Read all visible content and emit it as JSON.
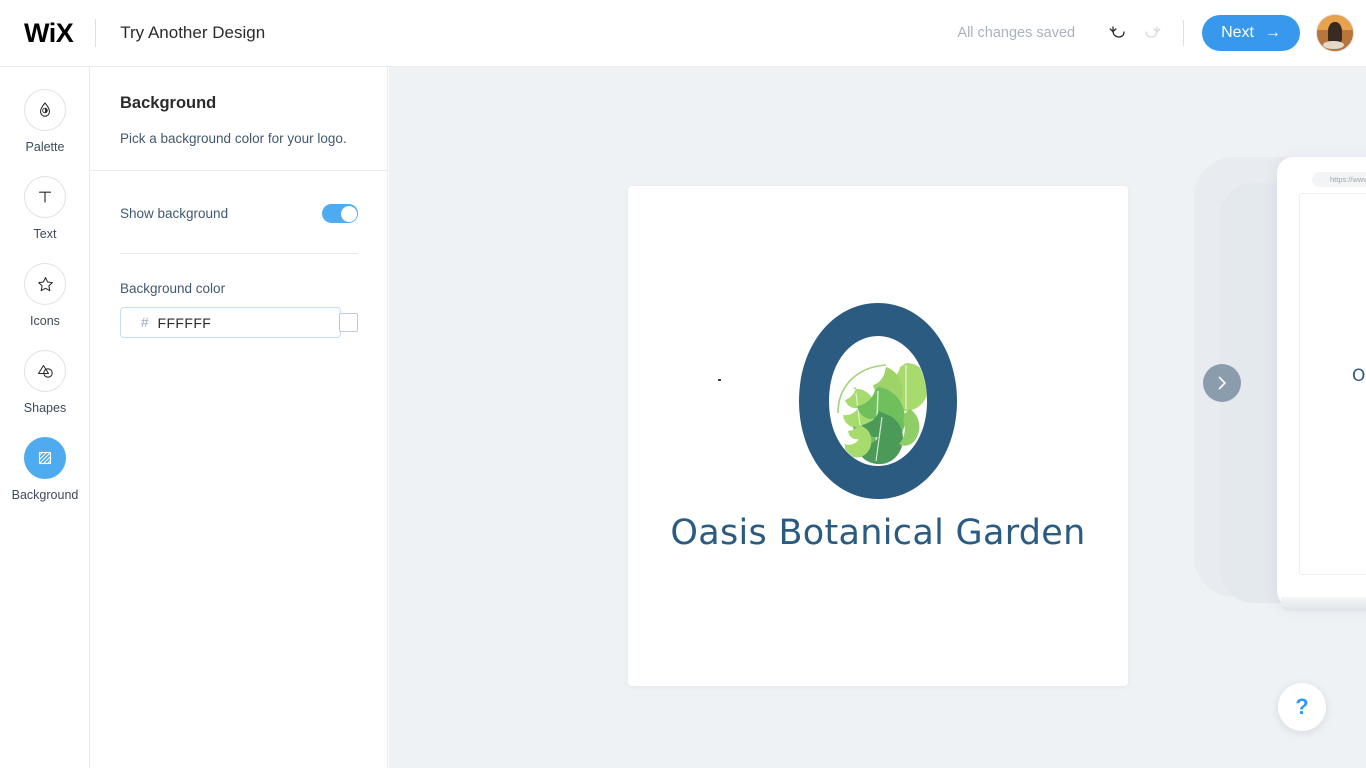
{
  "header": {
    "brand": "WiX",
    "title": "Try Another Design",
    "save_status": "All changes saved",
    "undo_icon": "undo-arrow-icon",
    "redo_icon": "redo-arrow-icon",
    "next_label": "Next",
    "next_arrow": "→",
    "avatar_alt": "user-avatar"
  },
  "sidebar": {
    "items": [
      {
        "label": "Palette",
        "icon": "droplet-icon",
        "active": false
      },
      {
        "label": "Text",
        "icon": "text-t-icon",
        "active": false
      },
      {
        "label": "Icons",
        "icon": "star-icon",
        "active": false
      },
      {
        "label": "Shapes",
        "icon": "shapes-icon",
        "active": false
      },
      {
        "label": "Background",
        "icon": "background-hatch-icon",
        "active": true
      }
    ]
  },
  "panel": {
    "title": "Background",
    "description": "Pick a background color for your logo.",
    "toggle_label": "Show background",
    "toggle_on": true,
    "color_label": "Background color",
    "hash_symbol": "#",
    "color_value": "FFFFFF",
    "color_placeholder": "FFFFFF",
    "swatch_color": "#FFFFFF"
  },
  "canvas": {
    "background_color": "#EFF2F5",
    "logo": {
      "card_background": "#FFFFFF",
      "business_name": "Oasis Botanical Garden",
      "mark_color": "#2B5B80",
      "text_color": "#2B5B80",
      "leaf_light": "#A8DB6E",
      "leaf_mid": "#74C25F",
      "leaf_dark": "#4C9A57"
    },
    "preview_device": {
      "url_text": "https://www.m",
      "device_logo_text": "Oa"
    },
    "next_slide_icon": "chevron-right-icon",
    "help_icon": "question-mark-icon",
    "accent_color": "#3899EC"
  }
}
